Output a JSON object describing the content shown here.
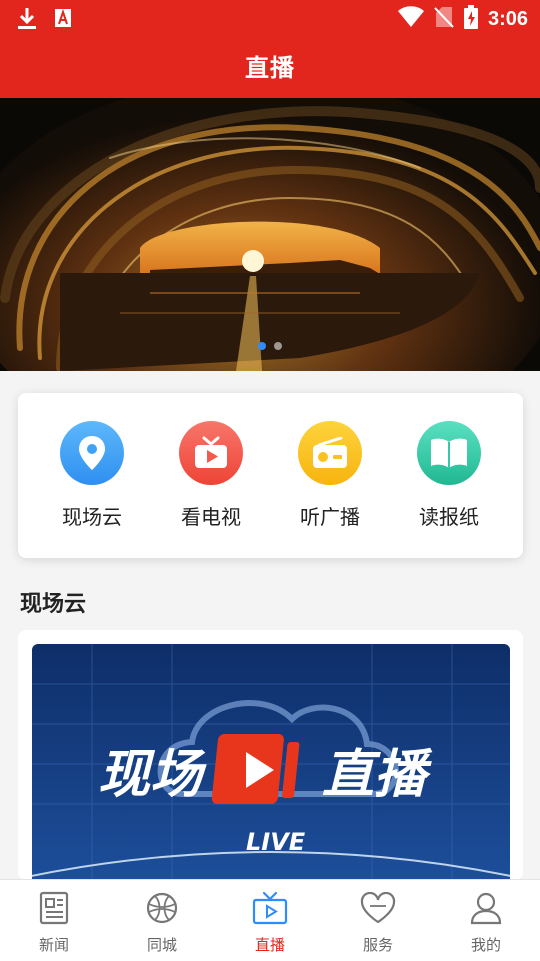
{
  "status_bar": {
    "time": "3:06"
  },
  "header": {
    "title": "直播"
  },
  "banner": {
    "slide_count": 2,
    "active_slide": 1
  },
  "quick_entries": [
    {
      "label": "现场云",
      "icon": "location-pin-icon",
      "color": "#3fa3f5"
    },
    {
      "label": "看电视",
      "icon": "tv-icon",
      "color": "#f35a4e"
    },
    {
      "label": "听广播",
      "icon": "radio-icon",
      "color": "#fbc21f"
    },
    {
      "label": "读报纸",
      "icon": "book-icon",
      "color": "#36c9a9"
    }
  ],
  "section": {
    "title": "现场云"
  },
  "live_card": {
    "headline_left": "现场",
    "headline_right": "直播",
    "tag": "LIVE"
  },
  "bottom_nav": [
    {
      "label": "新闻",
      "icon": "newspaper-icon",
      "active": false
    },
    {
      "label": "同城",
      "icon": "city-globe-icon",
      "active": false
    },
    {
      "label": "直播",
      "icon": "live-tv-icon",
      "active": true
    },
    {
      "label": "服务",
      "icon": "heart-icon",
      "active": false
    },
    {
      "label": "我的",
      "icon": "user-icon",
      "active": false
    }
  ],
  "colors": {
    "brand": "#e3261d",
    "active_dot": "#2f8cff",
    "nav_inactive": "#666666"
  }
}
